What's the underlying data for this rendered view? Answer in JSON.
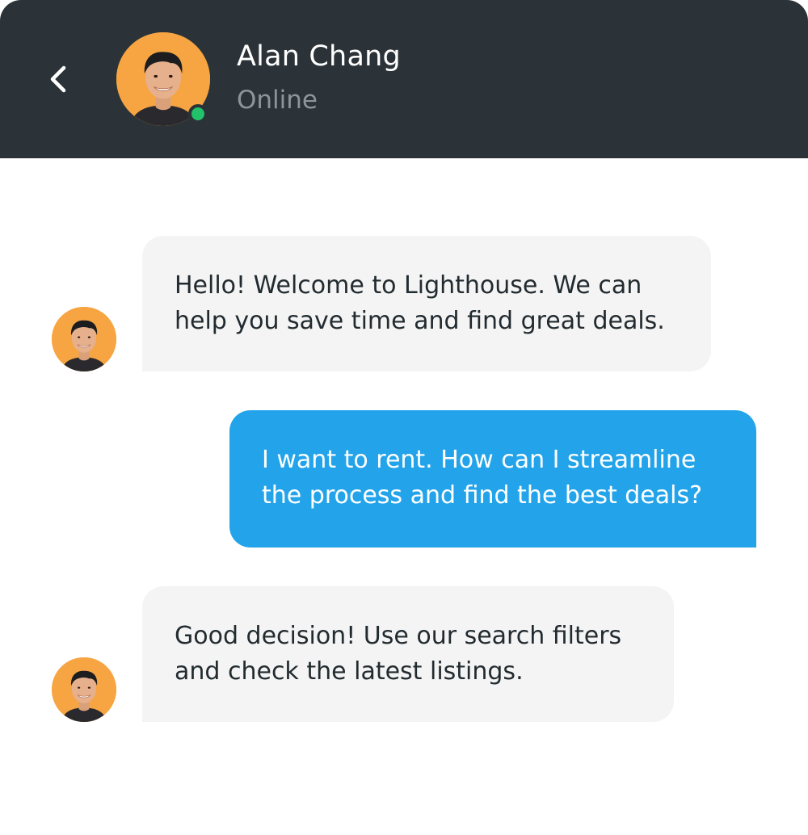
{
  "header": {
    "contact_name": "Alan Chang",
    "contact_status": "Online",
    "background_color": "#2b3338",
    "status_color": "#22c26a",
    "back_icon": "chevron-left-icon"
  },
  "avatar": {
    "background_color": "#f6a542"
  },
  "messages": [
    {
      "direction": "incoming",
      "lines": [
        "Hello! Welcome to Lighthouse. We can",
        "help you save time and find great deals."
      ]
    },
    {
      "direction": "outgoing",
      "lines": [
        "I want to rent. How can I streamline",
        "the process and find the best deals?"
      ]
    },
    {
      "direction": "incoming",
      "lines": [
        "Good decision! Use our search filters",
        "and check the latest listings."
      ]
    }
  ],
  "colors": {
    "incoming_bubble": "#f4f4f4",
    "outgoing_bubble": "#23a4ea",
    "incoming_text": "#222b30",
    "outgoing_text": "#ffffff"
  }
}
